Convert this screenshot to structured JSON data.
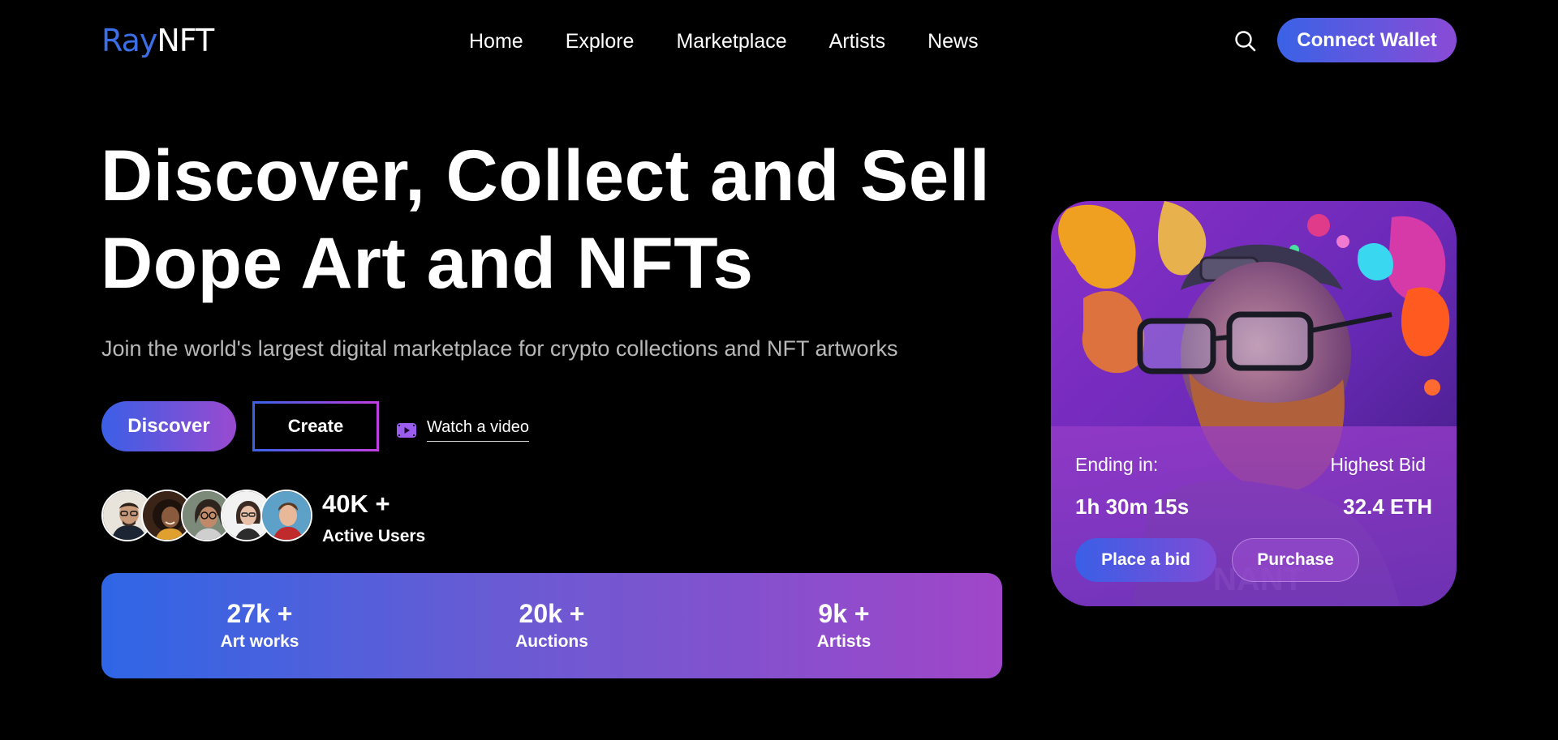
{
  "brand": {
    "part1": "Ray",
    "part2": "NFT",
    "accent": "#3b6fe8"
  },
  "nav": {
    "items": [
      {
        "label": "Home"
      },
      {
        "label": "Explore"
      },
      {
        "label": "Marketplace"
      },
      {
        "label": "Artists"
      },
      {
        "label": "News"
      }
    ],
    "search_icon": "search-icon",
    "connect_label": "Connect Wallet"
  },
  "hero": {
    "title_line1": "Discover, Collect and Sell",
    "title_line2": "Dope Art and NFTs",
    "subtitle": "Join the world's largest digital marketplace for crypto collections and NFT artworks",
    "discover_label": "Discover",
    "create_label": "Create",
    "video_label": "Watch a video",
    "video_icon": "video-play-icon"
  },
  "users": {
    "count": "40K +",
    "label": "Active Users",
    "avatar_count": 5
  },
  "stats": [
    {
      "value": "27k +",
      "label": "Art works"
    },
    {
      "value": "20k +",
      "label": "Auctions"
    },
    {
      "value": "9k +",
      "label": "Artists"
    }
  ],
  "card": {
    "ending_label": "Ending in:",
    "timer": "1h 30m 15s",
    "bid_label": "Highest Bid",
    "bid_value": "32.4 ETH",
    "bid_button": "Place a bid",
    "purchase_button": "Purchase"
  },
  "colors": {
    "gradient_start": "#3a62e6",
    "gradient_end": "#a046c8",
    "background": "#000000"
  }
}
